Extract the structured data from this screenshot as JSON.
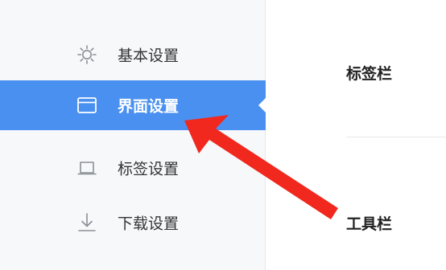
{
  "sidebar": {
    "items": [
      {
        "label": "基本设置",
        "icon": "gear-icon",
        "active": false
      },
      {
        "label": "界面设置",
        "icon": "window-icon",
        "active": true
      },
      {
        "label": "标签设置",
        "icon": "laptop-icon",
        "active": false
      },
      {
        "label": "下载设置",
        "icon": "download-icon",
        "active": false
      }
    ]
  },
  "main": {
    "sections": [
      {
        "label": "标签栏"
      },
      {
        "label": "工具栏"
      }
    ]
  },
  "colors": {
    "active_bg": "#4a90f0",
    "sidebar_bg": "#f7f8fa",
    "arrow": "#f0281e"
  }
}
